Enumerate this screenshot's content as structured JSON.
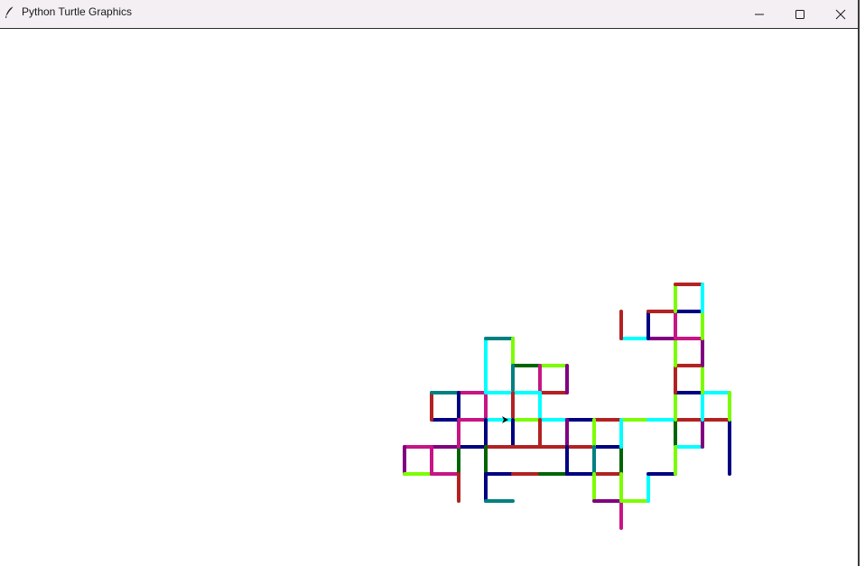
{
  "window": {
    "title": "Python Turtle Graphics",
    "app_icon": "feather-icon",
    "controls": {
      "minimize_icon": "minimize-icon",
      "maximize_icon": "maximize-icon",
      "close_icon": "close-icon"
    }
  },
  "canvas": {
    "background": "#ffffff",
    "palette": {
      "firebrick": "#b22222",
      "navy": "#000080",
      "cyan": "#00ffff",
      "lawngreen": "#7cfc00",
      "mediumvioletred": "#c71585",
      "purple": "#800080",
      "teal": "#008080",
      "darkgreen": "#006400"
    }
  }
}
